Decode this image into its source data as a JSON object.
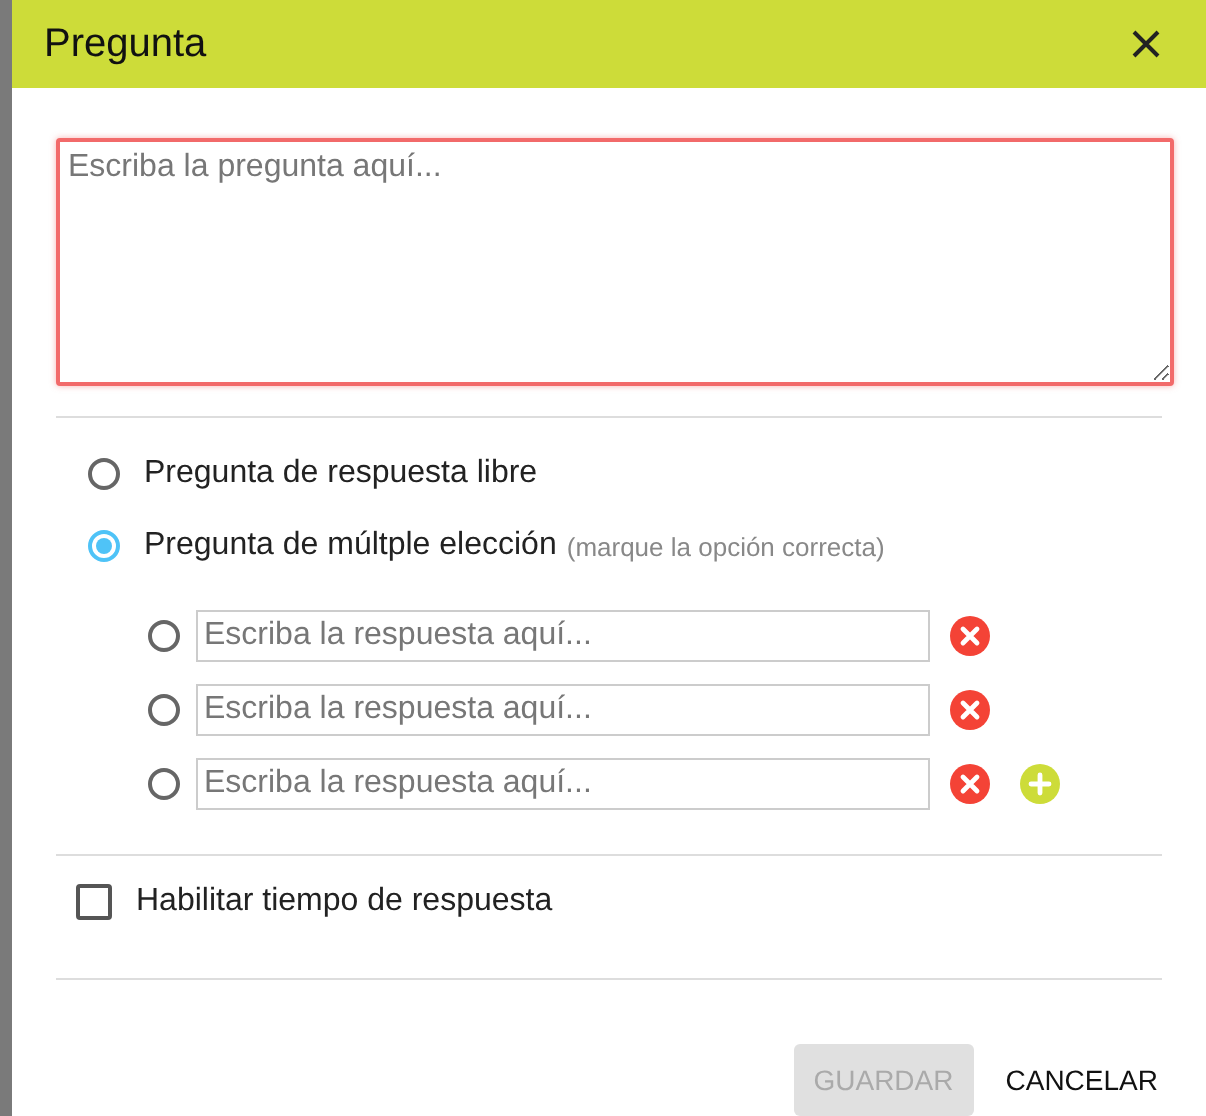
{
  "dialog": {
    "title": "Pregunta"
  },
  "question_field": {
    "placeholder": "Escriba la pregunta aquí...",
    "invalid": true
  },
  "question_types": [
    {
      "label": "Pregunta de respuesta libre",
      "selected": false
    },
    {
      "label": "Pregunta de múltple elección",
      "hint": "(marque la opción correcta)",
      "selected": true
    }
  ],
  "answers": [
    {
      "placeholder": "Escriba la respuesta aquí...",
      "selected": false
    },
    {
      "placeholder": "Escriba la respuesta aquí...",
      "selected": false
    },
    {
      "placeholder": "Escriba la respuesta aquí...",
      "selected": false
    }
  ],
  "timer_option": {
    "label": "Habilitar tiempo de respuesta",
    "checked": false
  },
  "buttons": [
    {
      "label": "GUARDAR",
      "disabled": true
    },
    {
      "label": "CANCELAR",
      "disabled": false
    }
  ]
}
